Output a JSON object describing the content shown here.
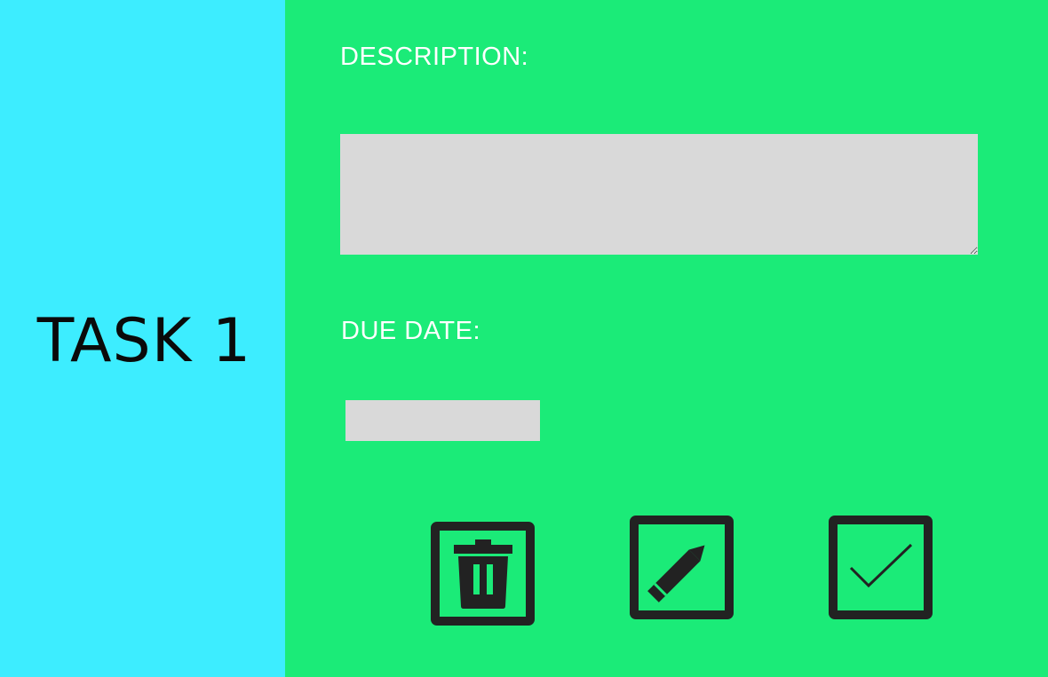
{
  "task": {
    "title": "TASK 1"
  },
  "form": {
    "description_label": "DESCRIPTION:",
    "description_value": "",
    "due_date_label": "DUE DATE:",
    "due_date_value": ""
  },
  "actions": {
    "delete_icon": "trash-icon",
    "edit_icon": "pencil-icon",
    "complete_icon": "checkmark-icon"
  },
  "colors": {
    "task_panel": "#3dedff",
    "main_panel": "#1beb78",
    "input_fill": "#d9d9d9",
    "icon_color": "#222222",
    "label_text": "#ffffff"
  }
}
